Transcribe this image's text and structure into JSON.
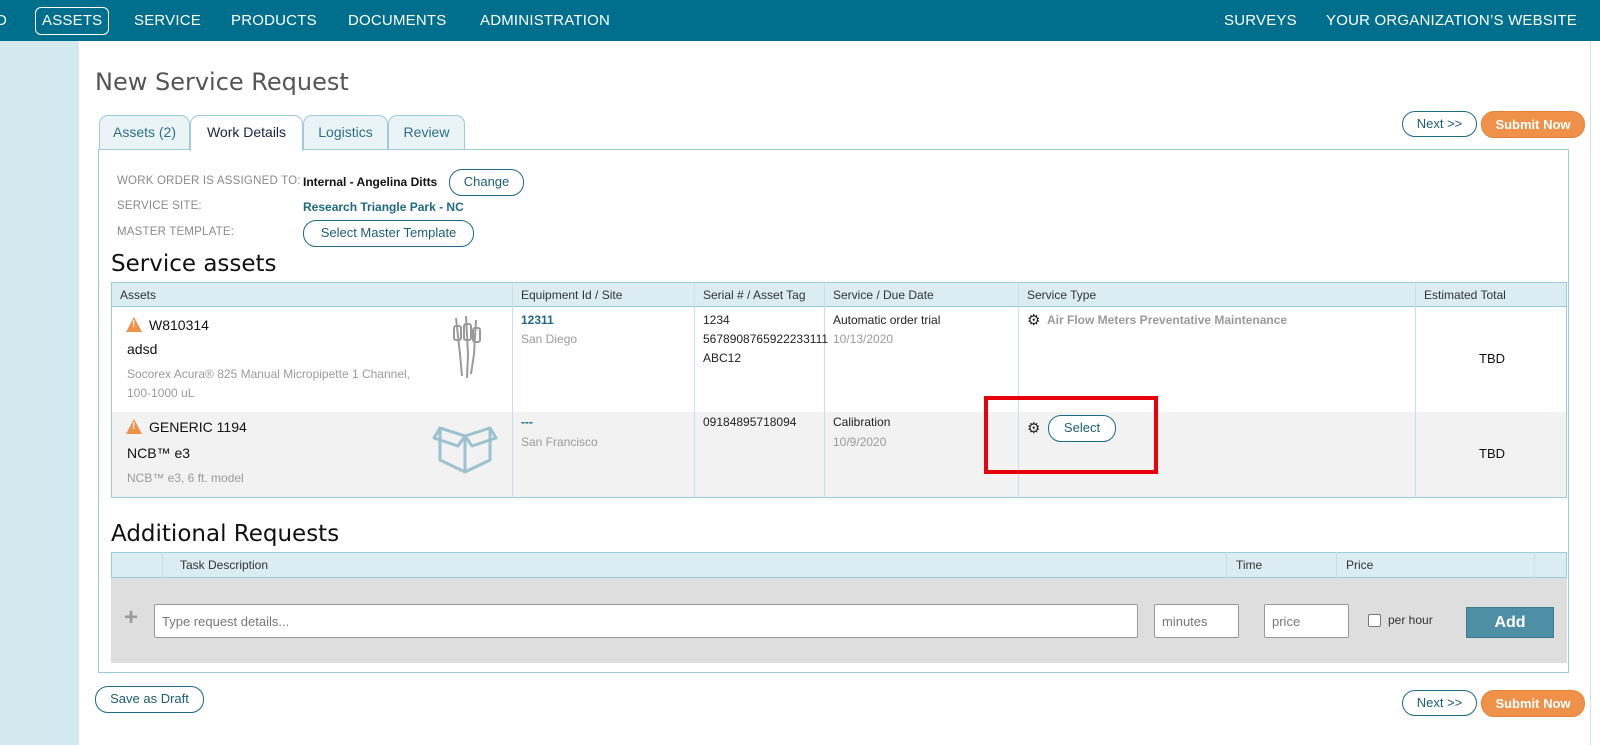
{
  "nav": {
    "left_items": [
      {
        "label": "ASSETS"
      },
      {
        "label": "SERVICE"
      },
      {
        "label": "PRODUCTS"
      },
      {
        "label": "DOCUMENTS"
      },
      {
        "label": "ADMINISTRATION"
      }
    ],
    "right_items": [
      {
        "label": "SURVEYS"
      },
      {
        "label": "YOUR ORGANIZATION’S WEBSITE"
      }
    ],
    "colors": {
      "bar": "#006f8e",
      "sidebar": "#d3e8ef"
    }
  },
  "page": {
    "title": "New Service Request"
  },
  "tabs": [
    {
      "label": "Assets (2)"
    },
    {
      "label": "Work Details"
    },
    {
      "label": "Logistics"
    },
    {
      "label": "Review"
    }
  ],
  "actions": {
    "next_label": "Next >>",
    "submit_label": "Submit Now",
    "save_draft_label": "Save as Draft",
    "accent": "#f0914a"
  },
  "work_details": {
    "assigned_label": "WORK ORDER IS ASSIGNED TO:",
    "assigned_value": "Internal - Angelina Ditts",
    "change_label": "Change",
    "site_label": "SERVICE SITE:",
    "site_value": "Research Triangle Park - NC",
    "template_label": "MASTER TEMPLATE:",
    "template_button": "Select Master Template"
  },
  "service_assets": {
    "title": "Service assets",
    "headers": [
      "Assets",
      "Equipment Id / Site",
      "Serial # / Asset Tag",
      "Service / Due Date",
      "Service Type",
      "Estimated Total"
    ],
    "rows": [
      {
        "asset_id": "W810314",
        "name": "adsd",
        "desc_line1": "Socorex Acura® 825 Manual Micropipette 1 Channel,",
        "desc_line2": "100-1000 uL",
        "equipment_id": "12311",
        "site": "San Diego",
        "serial_1": "1234",
        "serial_2": "5678908765922233111",
        "serial_3": "ABC12",
        "service": "Automatic order trial",
        "due_date": "10/13/2020",
        "service_type": "Air Flow Meters Preventative Maintenance",
        "total": "TBD",
        "image_icon": "pipette-image"
      },
      {
        "asset_id": "GENERIC 1194",
        "name": "NCB™ e3",
        "desc_line1": "NCB™ e3, 6 ft. model",
        "equipment_id": "---",
        "site": "San Francisco",
        "serial_1": "09184895718094",
        "service": "Calibration",
        "due_date": "10/9/2020",
        "service_type_button": "Select",
        "total": "TBD",
        "image_icon": "box-icon"
      }
    ]
  },
  "additional_requests": {
    "title": "Additional Requests",
    "headers": [
      "Task Description",
      "Time",
      "Price"
    ],
    "desc_placeholder": "Type request details...",
    "time_placeholder": "minutes",
    "price_placeholder": "price",
    "per_hour_label": "per hour",
    "add_label": "Add"
  }
}
